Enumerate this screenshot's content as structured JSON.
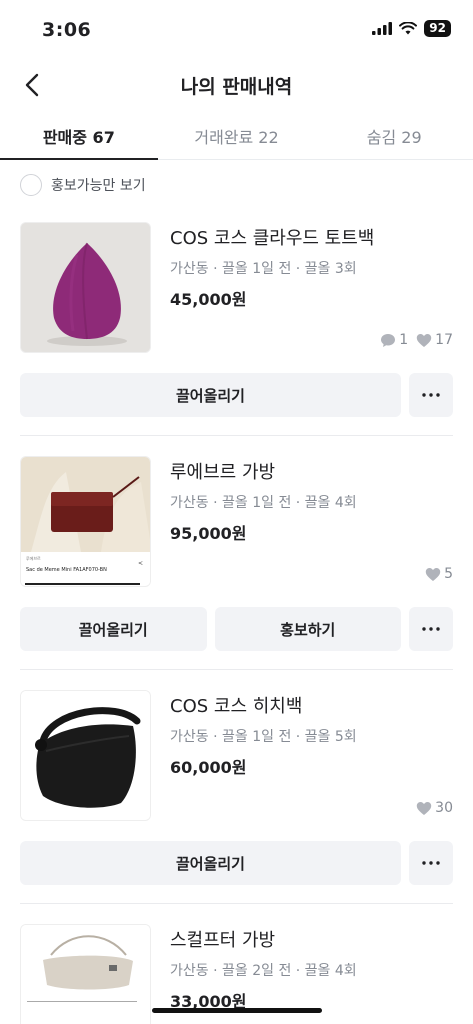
{
  "status_bar": {
    "time": "3:06",
    "battery": "92"
  },
  "header": {
    "title": "나의 판매내역"
  },
  "tabs": [
    {
      "label": "판매중 67",
      "active": true
    },
    {
      "label": "거래완료 22",
      "active": false
    },
    {
      "label": "숨김 29",
      "active": false
    }
  ],
  "filter": {
    "label": "홍보가능만 보기"
  },
  "items": [
    {
      "title": "COS 코스 클라우드 토트백",
      "meta": "가산동 · 끌올 1일 전 · 끌올 3회",
      "price": "45,000원",
      "chats": "1",
      "likes": "17",
      "bump_label": "끌어올리기"
    },
    {
      "title": "루에브르 가방",
      "meta": "가산동 · 끌올 1일 전 · 끌올 4회",
      "price": "95,000원",
      "likes": "5",
      "thumb_caption": "Sac de Meme Mini FA1AF070-BN",
      "thumb_small": "루에브르",
      "bump_label": "끌어올리기",
      "promote_label": "홍보하기"
    },
    {
      "title": "COS 코스 히치백",
      "meta": "가산동 · 끌올 1일 전 · 끌올 5회",
      "price": "60,000원",
      "likes": "30",
      "bump_label": "끌어올리기"
    },
    {
      "title": "스컬프터 가방",
      "meta": "가산동 · 끌올 2일 전 · 끌올 4회",
      "price": "33,000원"
    }
  ],
  "colors": {
    "text": "#212124",
    "muted": "#868b94",
    "button_bg": "#f2f3f6",
    "bag_purple": "#8e2a78"
  }
}
